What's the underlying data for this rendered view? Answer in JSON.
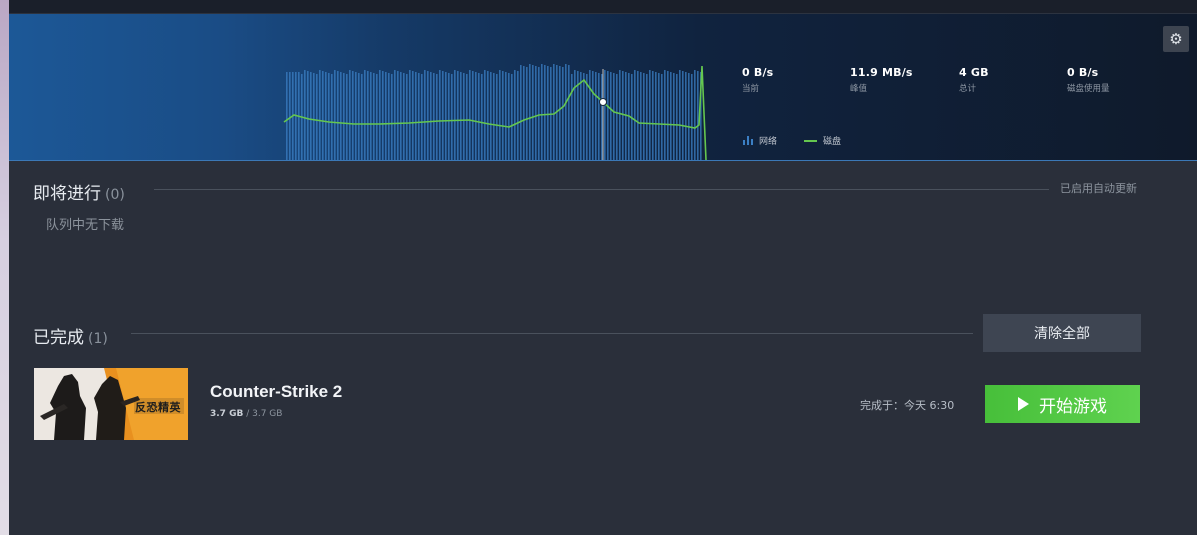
{
  "stats": [
    {
      "value": "0 B/s",
      "label": "当前"
    },
    {
      "value": "11.9 MB/s",
      "label": "峰值"
    },
    {
      "value": "4 GB",
      "label": "总计"
    },
    {
      "value": "0 B/s",
      "label": "磁盘使用量"
    }
  ],
  "legend": {
    "network": "网络",
    "disk": "磁盘"
  },
  "settings_icon": "gear-icon",
  "upcoming": {
    "title": "即将进行",
    "count": "(0)",
    "auto_update": "已启用自动更新",
    "empty_message": "队列中无下载"
  },
  "completed": {
    "title": "已完成",
    "count": "(1)",
    "clear_all": "清除全部"
  },
  "game": {
    "title": "Counter-Strike 2",
    "downloaded": "3.7 GB",
    "separator": "/",
    "total": "3.7 GB",
    "completed_at": "完成于：今天 6:30",
    "play_label": "开始游戏",
    "thumbnail_text": "反恐精英"
  },
  "colors": {
    "network_bar": "#3b7fc4",
    "disk_line": "#65c74f",
    "play_button": "#5fd24f"
  }
}
